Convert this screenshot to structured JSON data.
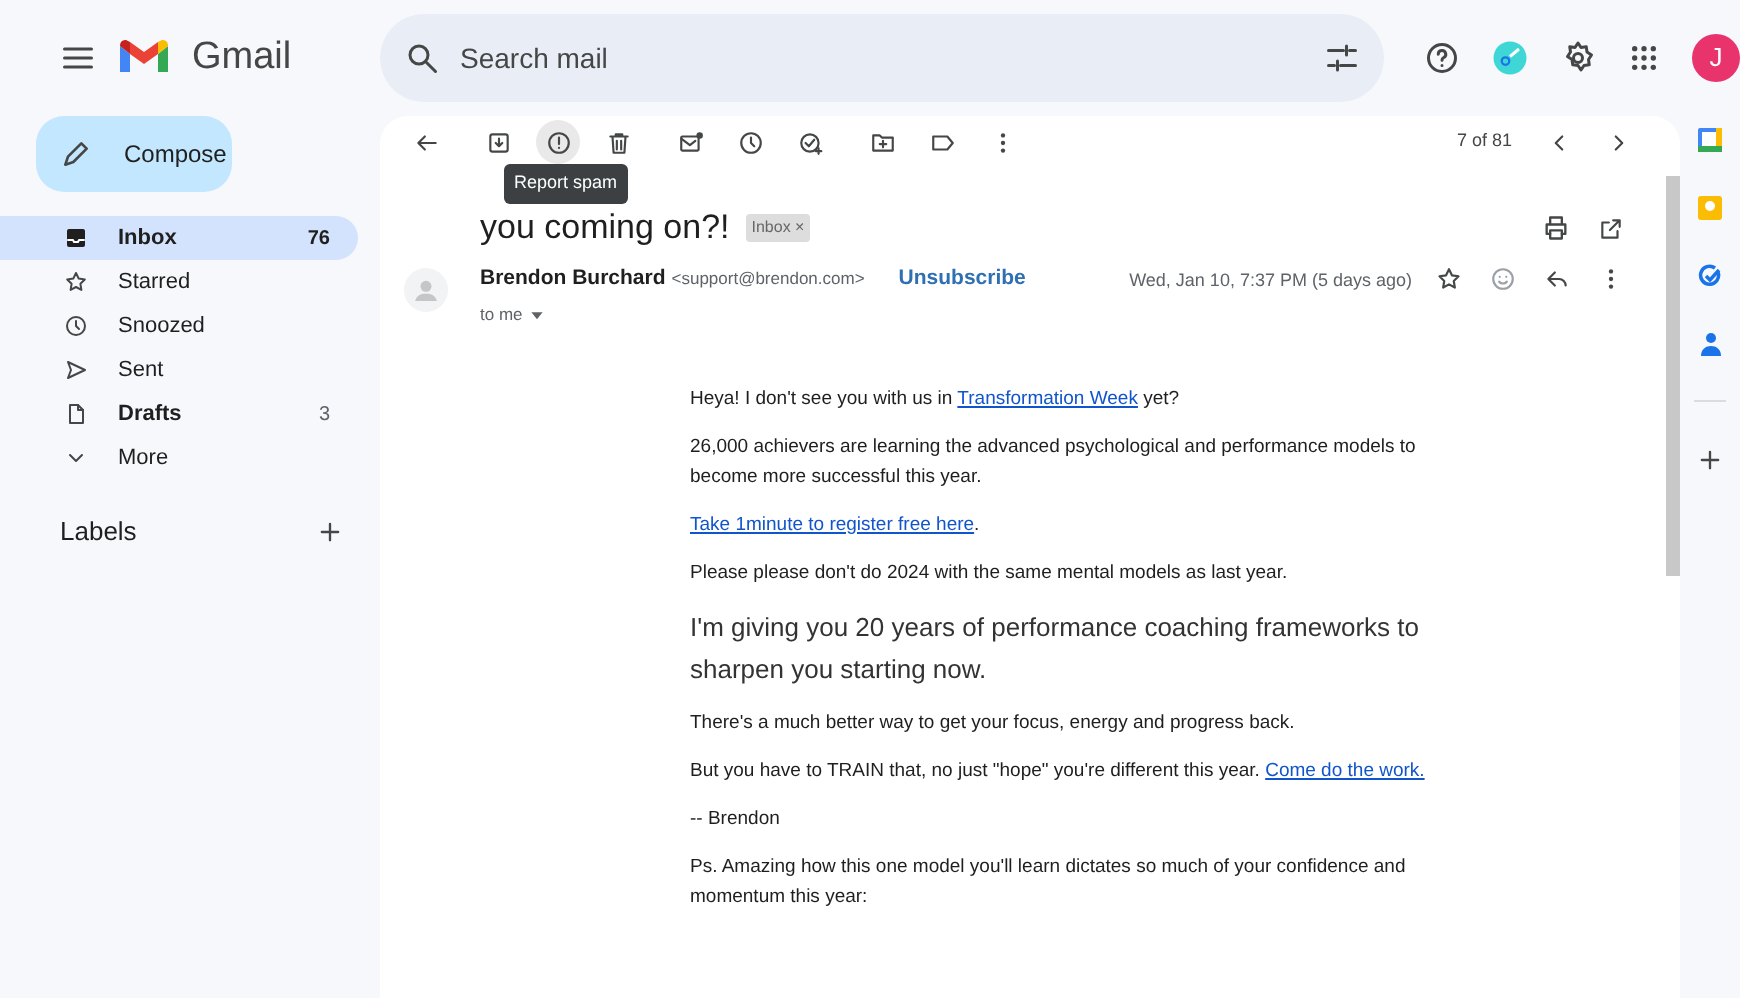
{
  "app": {
    "name": "Gmail"
  },
  "search": {
    "placeholder": "Search mail"
  },
  "account": {
    "initial": "J"
  },
  "compose": {
    "label": "Compose"
  },
  "sidebar": {
    "items": [
      {
        "label": "Inbox",
        "count": "76",
        "selected": true,
        "unread": true
      },
      {
        "label": "Starred",
        "selected": false,
        "unread": false
      },
      {
        "label": "Snoozed",
        "selected": false,
        "unread": false
      },
      {
        "label": "Sent",
        "selected": false,
        "unread": false
      },
      {
        "label": "Drafts",
        "count": "3",
        "selected": false,
        "unread": true
      },
      {
        "label": "More",
        "selected": false,
        "unread": false
      }
    ],
    "labels_heading": "Labels"
  },
  "toolbar": {
    "tooltip": "Report spam",
    "pager": "7 of 81"
  },
  "message": {
    "subject": "you coming on?!",
    "label": "Inbox",
    "label_remove": "×",
    "sender_name": "Brendon Burchard",
    "sender_email": "<support@brendon.com>",
    "unsubscribe": "Unsubscribe",
    "date": "Wed, Jan 10, 7:37 PM (5 days ago)",
    "recipient": "to me",
    "paragraphs": [
      {
        "kind": "normal",
        "parts": [
          {
            "text": "Heya! I don't see you with us in ",
            "link": false
          },
          {
            "text": "Transformation Week",
            "link": true
          },
          {
            "text": " yet?",
            "link": false
          }
        ]
      },
      {
        "kind": "normal",
        "parts": [
          {
            "text": "26,000 achievers are learning the advanced psychological and performance models to become more successful this year.",
            "link": false
          }
        ]
      },
      {
        "kind": "normal",
        "parts": [
          {
            "text": "Take 1minute to register free here",
            "link": true
          },
          {
            "text": ".",
            "link": false
          }
        ]
      },
      {
        "kind": "normal",
        "parts": [
          {
            "text": "Please please don't do 2024 with the same mental models as last year.",
            "link": false
          }
        ]
      },
      {
        "kind": "lead",
        "parts": [
          {
            "text": "I'm giving you 20 years of performance coaching frameworks to sharpen you starting now.",
            "link": false
          }
        ]
      },
      {
        "kind": "normal",
        "parts": [
          {
            "text": "There's a much better way to get your focus, energy and progress back.",
            "link": false
          }
        ]
      },
      {
        "kind": "normal",
        "parts": [
          {
            "text": "But you have to TRAIN that, no just \"hope\" you're different this year. ",
            "link": false
          },
          {
            "text": "Come do the work.",
            "link": true
          }
        ]
      },
      {
        "kind": "normal",
        "parts": [
          {
            "text": "-- Brendon",
            "link": false
          }
        ]
      },
      {
        "kind": "normal",
        "parts": [
          {
            "text": "Ps. Amazing how this one model you'll learn dictates so much of your confidence and momentum this year:",
            "link": false
          }
        ]
      }
    ]
  }
}
